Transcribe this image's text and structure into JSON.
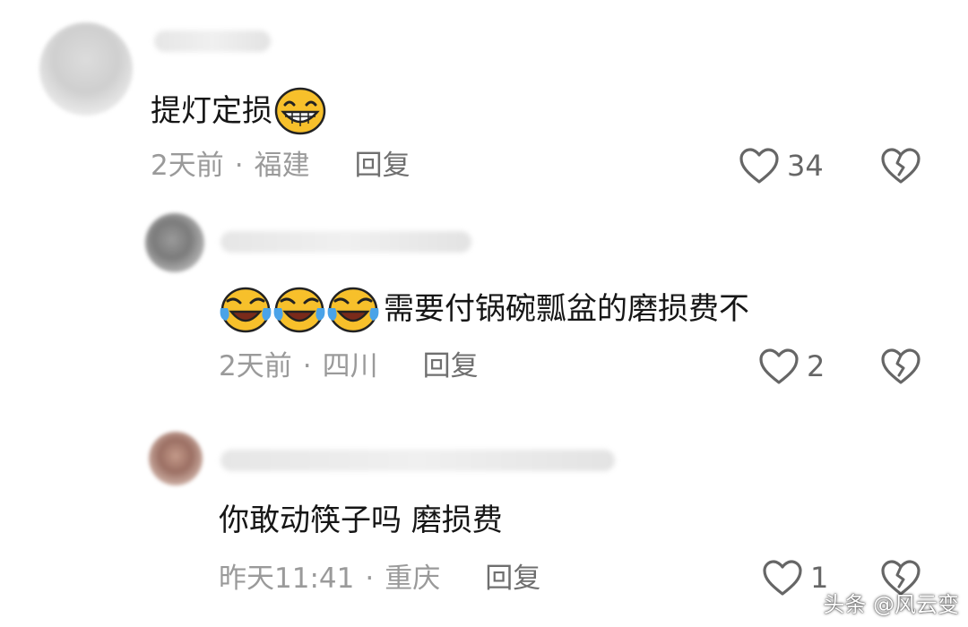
{
  "comments": [
    {
      "text": "提灯定损",
      "time": "2天前",
      "location": "福建",
      "reply_label": "回复",
      "likes": "34"
    },
    {
      "text": "需要付锅碗瓢盆的磨损费不",
      "time": "2天前",
      "location": "四川",
      "reply_label": "回复",
      "likes": "2"
    },
    {
      "text": "你敢动筷子吗 磨损费",
      "time": "昨天11:41",
      "location": "重庆",
      "reply_label": "回复",
      "likes": "1"
    }
  ],
  "separator": "·",
  "watermark": "头条 @风云变",
  "icons": {
    "like": "heart-outline-icon",
    "dislike": "broken-heart-icon",
    "emoji_grin": "grinning-face-icon",
    "emoji_cry_laugh": "tears-of-joy-icon"
  },
  "colors": {
    "text": "#161616",
    "meta": "#9a9a9a",
    "reply": "#6f6f6f",
    "icon": "#666666",
    "emoji_yellow": "#f7c02b"
  }
}
